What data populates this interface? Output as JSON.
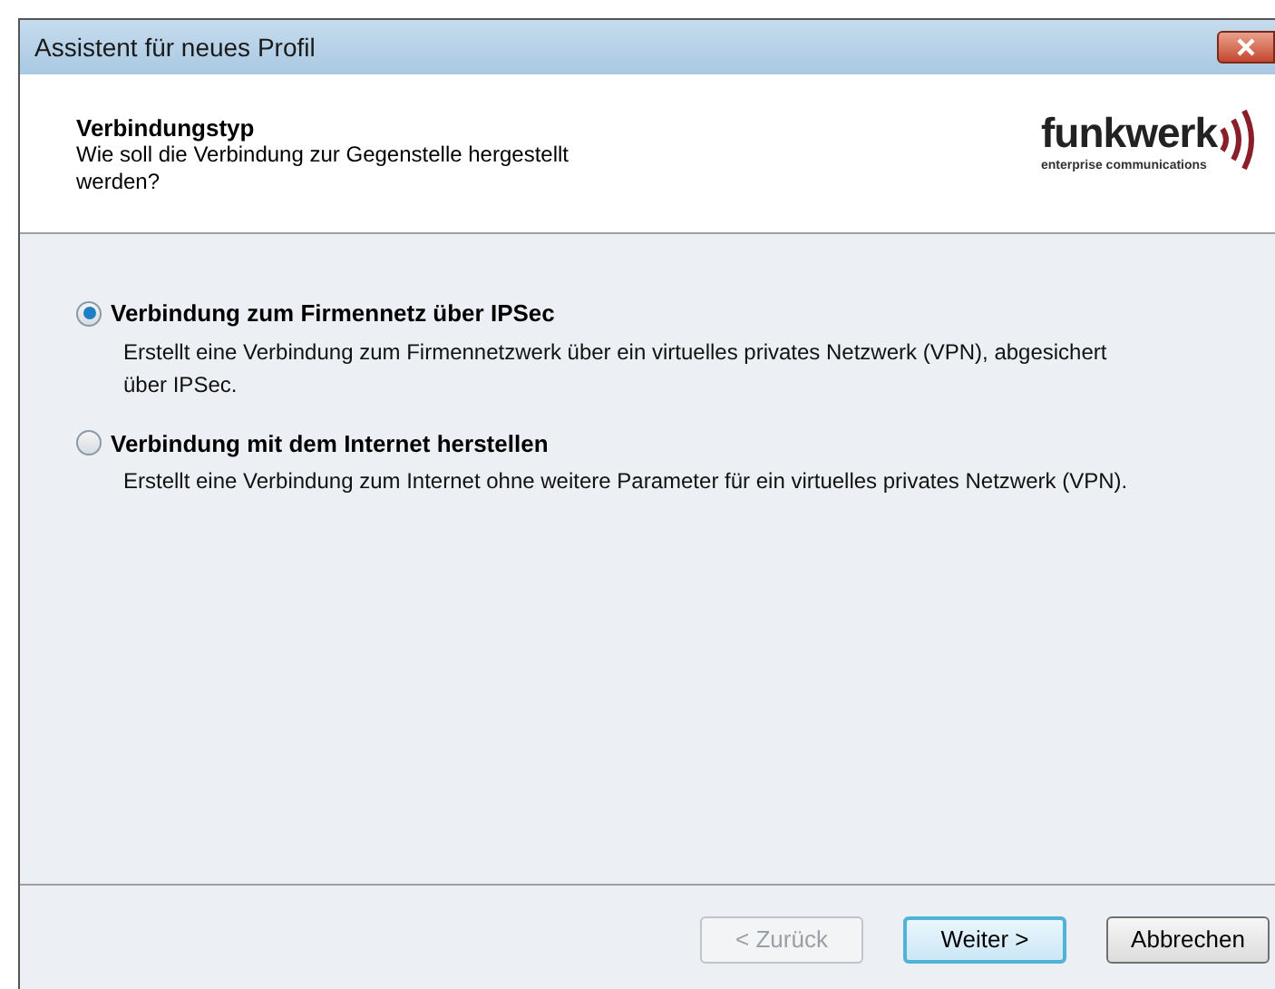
{
  "window": {
    "title": "Assistent für neues Profil"
  },
  "header": {
    "title": "Verbindungstyp",
    "subtitle": "Wie soll die Verbindung zur Gegenstelle hergestellt werden?",
    "logo": {
      "name": "funkwerk",
      "tagline": "enterprise communications"
    }
  },
  "options": [
    {
      "label": "Verbindung zum Firmennetz über IPSec",
      "description": "Erstellt eine Verbindung zum Firmennetzwerk über ein virtuelles privates Netzwerk (VPN), abgesichert über IPSec.",
      "selected": true
    },
    {
      "label": "Verbindung mit dem Internet herstellen",
      "description": "Erstellt eine Verbindung zum Internet ohne weitere Parameter für ein virtuelles privates Netzwerk (VPN).",
      "selected": false
    }
  ],
  "buttons": [
    {
      "label": "< Zurück",
      "disabled": true,
      "default": false
    },
    {
      "label": "Weiter >",
      "disabled": false,
      "default": true
    },
    {
      "label": "Abbrechen",
      "disabled": false,
      "default": false
    }
  ]
}
